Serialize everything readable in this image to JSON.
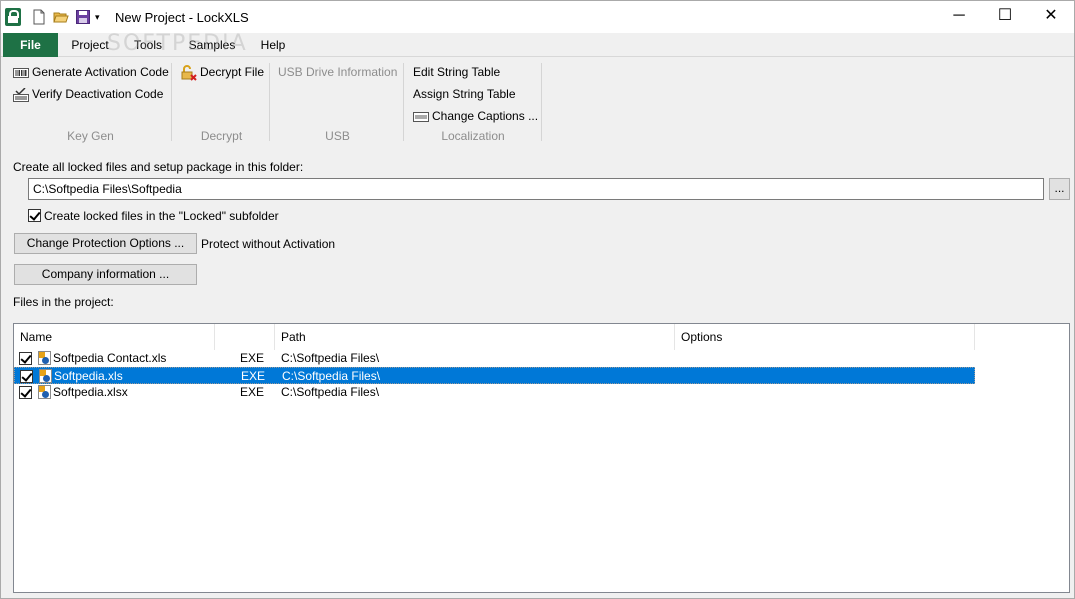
{
  "window": {
    "title": "New Project - LockXLS",
    "controls": {
      "minimize": "─",
      "maximize": "☐",
      "close": "✕"
    },
    "quick_access_more": "▾"
  },
  "watermark": "SOFTPEDIA",
  "tabs": [
    {
      "label": "File"
    },
    {
      "label": "Project"
    },
    {
      "label": "Tools"
    },
    {
      "label": "Samples"
    },
    {
      "label": "Help"
    }
  ],
  "ribbon": {
    "keygen": {
      "label": "Key Gen",
      "generate_activation": "Generate Activation Code",
      "verify_deactivation": "Verify Deactivation Code"
    },
    "decrypt": {
      "label": "Decrypt",
      "decrypt_file": "Decrypt File"
    },
    "usb": {
      "label": "USB",
      "usb_drive_info": "USB Drive Information"
    },
    "localization": {
      "label": "Localization",
      "edit_string_table": "Edit String Table",
      "assign_string_table": "Assign String Table",
      "change_captions": "Change Captions ..."
    }
  },
  "main": {
    "folder_label": "Create all locked files and setup package in this folder:",
    "folder_value": "C:\\Softpedia Files\\Softpedia",
    "browse_label": "...",
    "locked_subfolder_label": "Create locked files in the \"Locked\" subfolder",
    "locked_subfolder_checked": true,
    "change_protection_label": "Change Protection Options ...",
    "protection_status": "Protect without Activation",
    "company_info_label": "Company information ...",
    "files_label": "Files in the project:"
  },
  "file_list": {
    "columns": [
      "Name",
      "",
      "Path",
      "Options"
    ],
    "rows": [
      {
        "name": "Softpedia Contact.xls",
        "type": "EXE",
        "path": "C:\\Softpedia Files\\",
        "options": "",
        "checked": true,
        "selected": false
      },
      {
        "name": "Softpedia.xls",
        "type": "EXE",
        "path": "C:\\Softpedia Files\\",
        "options": "",
        "checked": true,
        "selected": true
      },
      {
        "name": "Softpedia.xlsx",
        "type": "EXE",
        "path": "C:\\Softpedia Files\\",
        "options": "",
        "checked": true,
        "selected": false
      }
    ]
  },
  "colors": {
    "accent": "#1e7145",
    "selection": "#0078d7"
  }
}
